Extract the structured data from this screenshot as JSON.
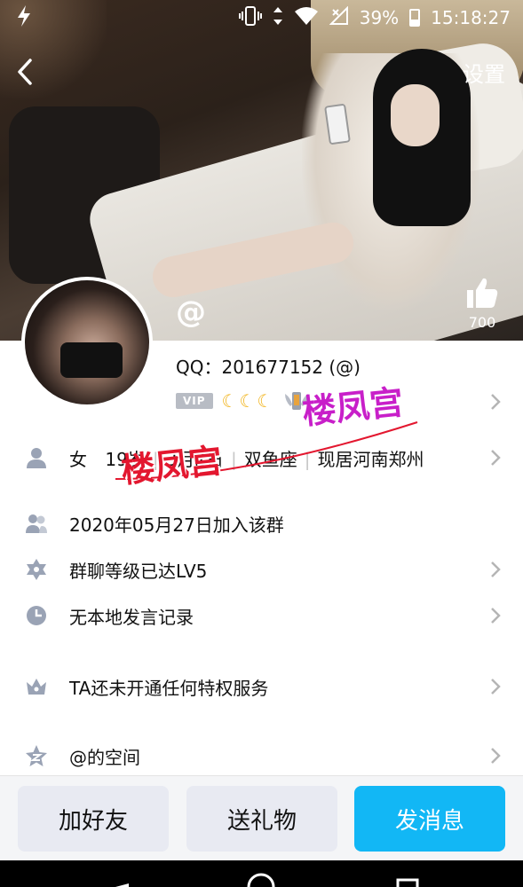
{
  "status_bar": {
    "battery_percent": "39%",
    "time": "15:18:27",
    "battery_level": 0.39
  },
  "header": {
    "settings_label": "设置"
  },
  "like": {
    "count": "700"
  },
  "profile": {
    "nickname": "@",
    "qq_line": "QQ：201677152 (@)",
    "vip_label": "VIP",
    "moons": "☾☾☾"
  },
  "info_rows": {
    "gender": "女",
    "age": "19岁",
    "birthday": "3月2日",
    "zodiac": "双鱼座",
    "location": "现居河南郑州",
    "joined": "2020年05月27日加入该群",
    "group_level": "群聊等级已达LV5",
    "speech_record": "无本地发言记录",
    "privilege": "TA还未开通任何特权服务",
    "space": "@的空间"
  },
  "watermarks": {
    "text_1": "楼凤宫",
    "text_2": "楼凤宫"
  },
  "actions": {
    "add_friend": "加好友",
    "send_gift": "送礼物",
    "send_message": "发消息"
  },
  "colors": {
    "accent_blue": "#12b7f5",
    "watermark_purple": "#c81fc9",
    "watermark_red": "#e3172f"
  }
}
